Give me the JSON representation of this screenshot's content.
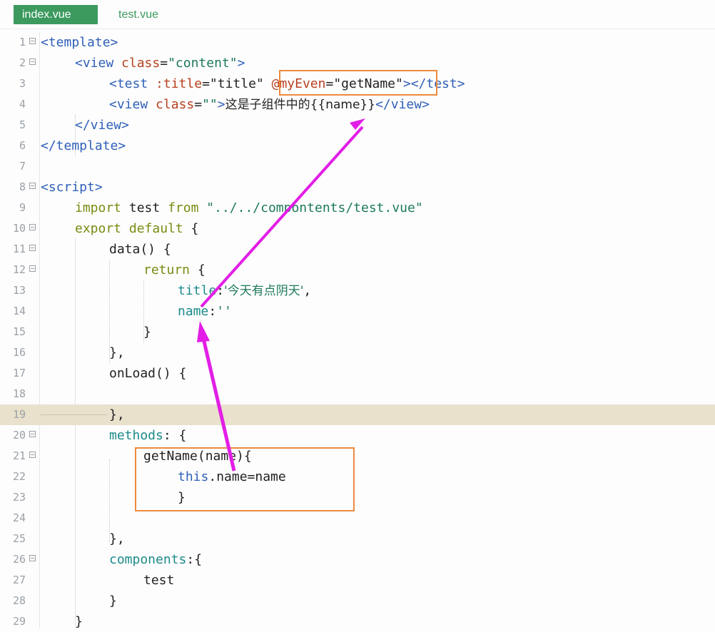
{
  "tabs": [
    {
      "label": "index.vue",
      "active": true
    },
    {
      "label": "test.vue",
      "active": false
    }
  ],
  "editor": {
    "line_numbers": [
      "1",
      "2",
      "3",
      "4",
      "5",
      "6",
      "7",
      "8",
      "9",
      "10",
      "11",
      "12",
      "13",
      "14",
      "15",
      "16",
      "17",
      "18",
      "19",
      "20",
      "21",
      "22",
      "23",
      "24",
      "25",
      "26",
      "27",
      "28",
      "29"
    ],
    "highlighted_line": "19",
    "code": {
      "l1": {
        "open": "<template>"
      },
      "l2": {
        "open": "<view",
        "attr": "class",
        "eq": "=",
        "val": "\"content\"",
        "close": ">"
      },
      "l3": {
        "open": "<test",
        "attr1": ":title",
        "eq1": "=",
        "val1": "\"title\"",
        "event": "@myEven",
        "eq2": "=",
        "val2": "\"getName\"",
        "close": "></test>"
      },
      "l4": {
        "open": "<view",
        "attr": "class",
        "eq": "=",
        "val": "\"\"",
        "close": ">",
        "text": "这是子组件中的{{name}}",
        "end": "</view>"
      },
      "l5": {
        "text": "</view>"
      },
      "l6": {
        "text": "</template>"
      },
      "l8": {
        "text": "<script>"
      },
      "l9": {
        "kw1": "import",
        "name": " test ",
        "kw2": "from",
        "str": " \"../../compontents/test.vue\""
      },
      "l10": {
        "kw": "export default",
        "rest": " {"
      },
      "l11": {
        "text": "data() {"
      },
      "l12": {
        "kw": "return",
        "rest": " {"
      },
      "l13": {
        "key": "title",
        "colon": ":",
        "str": "'今天有点阴天'",
        "comma": ","
      },
      "l14": {
        "key": "name",
        "colon": ":",
        "str": "''"
      },
      "l15": {
        "text": "}"
      },
      "l16": {
        "text": "},"
      },
      "l17": {
        "text": "onLoad() {"
      },
      "l19": {
        "text": "},"
      },
      "l20": {
        "key": "methods",
        "colon": ":",
        "rest": " {"
      },
      "l21": {
        "text": "getName(name){"
      },
      "l22": {
        "kw": "this",
        "rest": ".name=name"
      },
      "l23": {
        "text": "}"
      },
      "l25": {
        "text": "},"
      },
      "l26": {
        "key": "components",
        "colon": ":",
        "rest": "{"
      },
      "l27": {
        "text": "test"
      },
      "l28": {
        "text": "}"
      },
      "l29": {
        "text": "}"
      }
    }
  },
  "colors": {
    "tab_active": "#3c9a5f",
    "tag": "#2f5fb8",
    "attr": "#b8401f",
    "string": "#1d7a58",
    "keyword": "#7a8b12",
    "annotation_box": "#ed8a3d",
    "annotation_arrow": "#e21ee6",
    "highlight_line": "#e9e1cc"
  }
}
